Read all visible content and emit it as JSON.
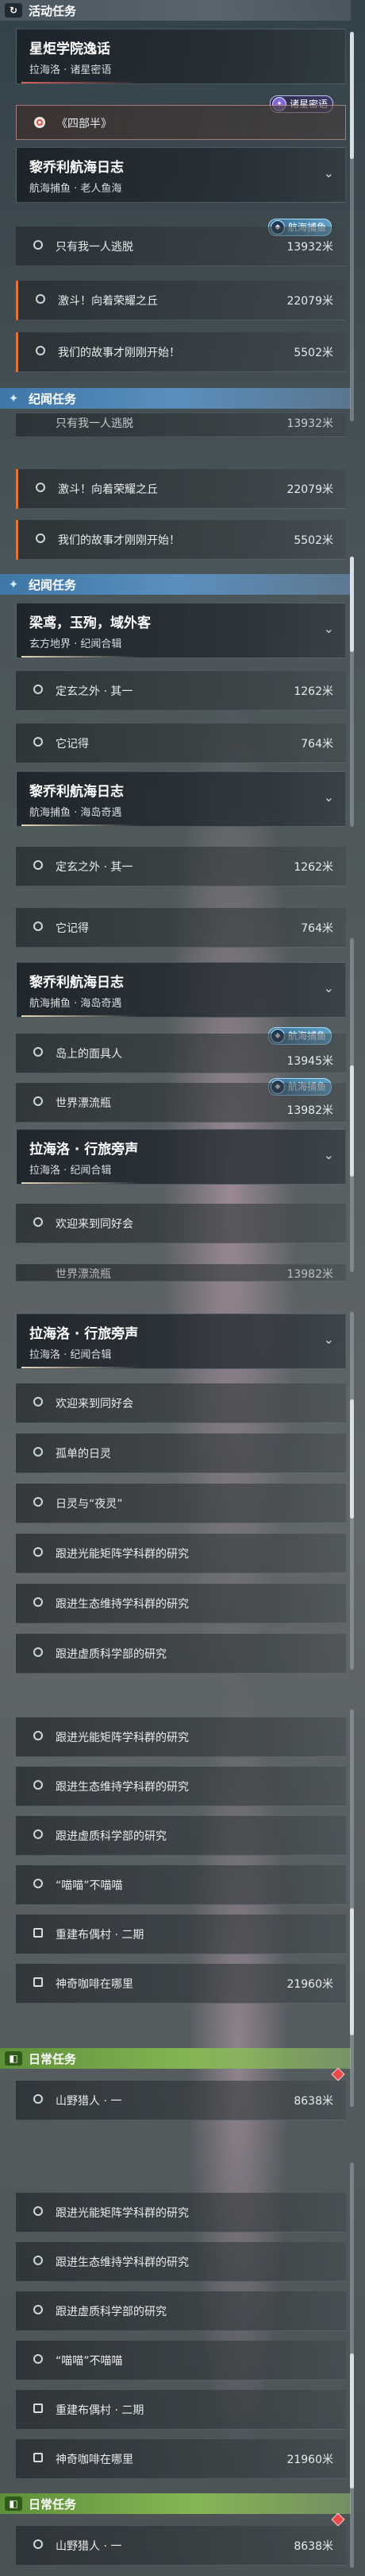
{
  "sections": {
    "active": "活动任务",
    "side": "纪闻任务",
    "daily": "日常任务"
  },
  "quests": {
    "xingju": {
      "title": "星炬学院逸话",
      "subtitle": "拉海洛 · 诸星密语",
      "step": "《四部半》",
      "tag": "诸星密语"
    },
    "liqiao": {
      "title": "黎乔利航海日志",
      "subtitle": "航海捕鱼 · 老人鱼海",
      "tag": "航海捕鱼"
    },
    "liqiao2": {
      "title": "黎乔利航海日志",
      "subtitle": "航海捕鱼 · 海岛奇遇"
    },
    "liangniao": {
      "title": "梁鸢，玉殉，域外客",
      "subtitle": "玄方地界 · 纪闻合辑"
    },
    "lahailuo": {
      "title": "拉海洛 · 行旅旁声",
      "subtitle": "拉海洛 · 纪闻合辑"
    },
    "lahailuo2": {
      "title": "拉海洛 · 行旅旁声",
      "subtitle": "拉海洛 · 纪闻合辑"
    }
  },
  "items": {
    "only_one_escape": {
      "label": "只有我一人逃脱",
      "dist": "13932米"
    },
    "charge": {
      "label": "激斗！向着荣耀之丘",
      "dist": "22079米"
    },
    "our_story": {
      "label": "我们的故事才刚刚开始！",
      "dist": "5502米"
    },
    "dingxuan": {
      "label": "定玄之外 · 其一",
      "dist": "1262米"
    },
    "taji": {
      "label": "它记得",
      "dist": "764米"
    },
    "island_mask": {
      "label": "岛上的面具人",
      "dist": "13945米"
    },
    "world_bottle": {
      "label": "世界漂流瓶",
      "dist": "13982米"
    },
    "welcome_tongyou": {
      "label": "欢迎来到同好会"
    },
    "lonely_soul": {
      "label": "孤单的日灵"
    },
    "sun_night": {
      "label": "日灵与“夜灵”"
    },
    "follow_light": {
      "label": "跟进光能矩阵学科群的研究"
    },
    "follow_eco": {
      "label": "跟进生态维持学科群的研究"
    },
    "follow_void": {
      "label": "跟进虚质科学部的研究"
    },
    "miaomiao": {
      "label": "“喵喵”不喵喵"
    },
    "rebuild": {
      "label": "重建布偶村 · 二期"
    },
    "coffee": {
      "label": "神奇咖啡在哪里",
      "dist": "21960米"
    },
    "wild_hunter": {
      "label": "山野猎人 · 一",
      "dist": "8638米"
    }
  },
  "partial": {
    "top_cut": "只有我一人逃脱",
    "top_cut_dist": "13932米",
    "bottle_cut": "世界漂流瓶",
    "bottle_cut_dist": "13982米"
  },
  "icons": {
    "active": "refresh-icon",
    "side": "sparkle-icon",
    "daily": "calendar-icon",
    "chevron": "chevron-down-icon",
    "bullet": "radio-circle-icon",
    "tracked": "target-icon",
    "tag": "fish-badge-icon"
  },
  "colors": {
    "active_header": "#59656e",
    "side_header": "#5a8fbd",
    "daily_header": "#86b653",
    "tracked_bar": "#e0743c",
    "alert": "#e64a4a"
  }
}
